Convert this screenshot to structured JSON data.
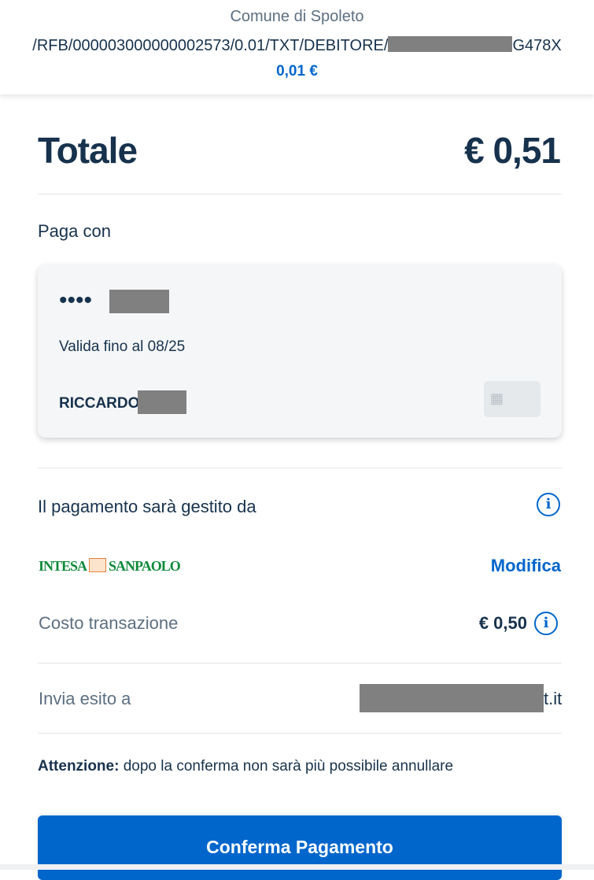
{
  "header": {
    "payee": "Comune di Spoleto",
    "reference_prefix": "/RFB/000003000000002573/0.01/TXT/DEBITORE/",
    "reference_suffix": "G478X",
    "amount": "0,01 €"
  },
  "summary": {
    "total_label": "Totale",
    "total_value": "€ 0,51"
  },
  "payment_method": {
    "section_label": "Paga con",
    "card_dots": "••••",
    "card_validity": "Valida fino al 08/25",
    "card_holder": "RICCARDO"
  },
  "psp": {
    "section_label": "Il pagamento sarà gestito da",
    "bank_name_left": "INTESA",
    "bank_name_right": "SANPAOLO",
    "modify_label": "Modifica"
  },
  "transaction": {
    "cost_label": "Costo transazione",
    "cost_value": "€ 0,50",
    "outcome_label": "Invia esito a",
    "outcome_email_tail": "t.it"
  },
  "warning": {
    "prefix": "Attenzione:",
    "text": " dopo la conferma non sarà più possibile annullare"
  },
  "actions": {
    "confirm_label": "Conferma Pagamento"
  },
  "icons": [
    "info-icon",
    "card-chip-icon",
    "bank-logo-emblem"
  ],
  "colors": {
    "accent": "#0066cc",
    "text_dark": "#17324d",
    "text_muted": "#5c6f82",
    "redaction": "#808080",
    "bank_green": "#0e8a3a"
  }
}
